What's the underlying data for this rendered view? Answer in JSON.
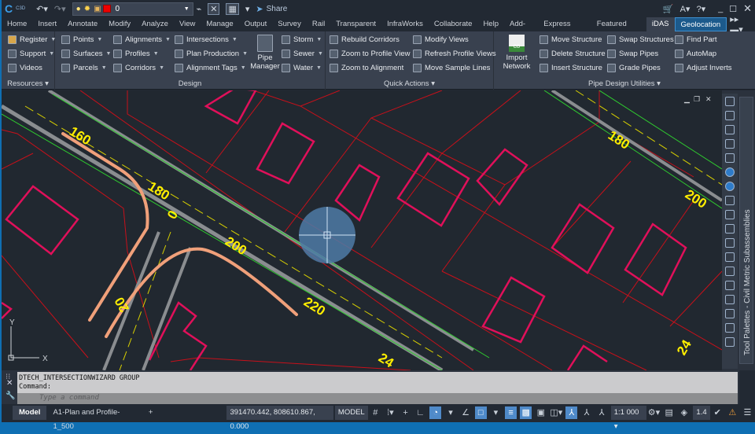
{
  "titlebar": {
    "app_badge": "C3D",
    "layer_value": "0",
    "share_label": "Share",
    "layer_color": "#e00000"
  },
  "tabs": [
    "Home",
    "Insert",
    "Annotate",
    "Modify",
    "Analyze",
    "View",
    "Manage",
    "Output",
    "Survey",
    "Rail",
    "Transparent",
    "InfraWorks",
    "Collaborate",
    "Help",
    "Add-ins",
    "Express Tools",
    "Featured Apps",
    "iDAS",
    "Geolocation"
  ],
  "ribbon": {
    "resources": {
      "title": "Resources",
      "items": [
        "Register",
        "Support",
        "Videos"
      ]
    },
    "design": {
      "title": "Design",
      "col1": [
        "Points",
        "Surfaces",
        "Parcels"
      ],
      "col2": [
        "Alignments",
        "Profiles",
        "Corridors"
      ],
      "col3": [
        "Intersections",
        "Plan Production",
        "Alignment Tags"
      ],
      "pipe_manager": "Pipe Manager",
      "col4": [
        "Storm",
        "Sewer",
        "Water"
      ]
    },
    "quick_actions": {
      "title": "Quick Actions",
      "col1": [
        "Rebuild Corridors",
        "Zoom to Profile View",
        "Zoom to Alignment"
      ],
      "col2": [
        "Modify Views",
        "Refresh Profile Views",
        "Move Sample Lines"
      ]
    },
    "pipe_design": {
      "title": "Pipe Design Utilities",
      "import_network": "Import Network",
      "import_badge": "CD",
      "col1": [
        "Move Structure",
        "Delete Structure",
        "Insert Structure"
      ],
      "col2": [
        "Swap Structures",
        "Swap Pipes",
        "Grade Pipes"
      ],
      "col3": [
        "Find Part",
        "AutoMap",
        "Adjust Inverts"
      ]
    }
  },
  "drawing": {
    "stations": [
      "160",
      "180",
      "0",
      "200",
      "220",
      "20",
      "24",
      "180",
      "200",
      "24"
    ],
    "ucs_x": "X",
    "ucs_y": "Y"
  },
  "palette": {
    "title": "Tool Palettes - Civil Metric Subassemblies"
  },
  "command": {
    "history": [
      "DTECH_INTERSECTIONWIZARD GROUP",
      "Command:"
    ],
    "placeholder": "Type a command"
  },
  "status": {
    "tabs": [
      "Model",
      "A1-Plan and Profile-1_500"
    ],
    "add": "+",
    "coords": "391470.442, 808610.867, 0.000",
    "model": "MODEL",
    "scale": "1:1 000",
    "lineweight": "1.4"
  }
}
